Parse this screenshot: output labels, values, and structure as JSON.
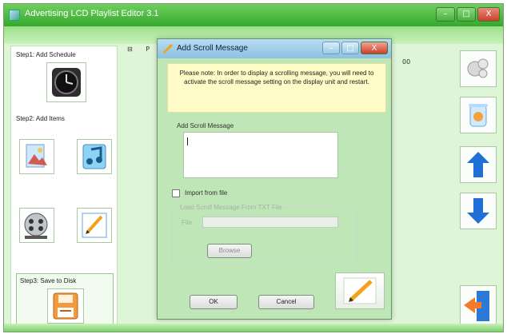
{
  "window": {
    "title": "Advertising LCD Playlist Editor 3.1",
    "controls": {
      "minimize": "–",
      "maximize": "□",
      "close": "X"
    }
  },
  "left_panel": {
    "step1_label": "Step1: Add Schedule",
    "step2_label": "Step2: Add Items",
    "step3_label": "Step3: Save to Disk"
  },
  "tree": {
    "root_glyph": "⊟",
    "root_text": "P",
    "time_text": "00"
  },
  "dialog": {
    "title": "Add Scroll Message",
    "note": "Please note: In order to display a scrolling message, you will need to activate the scroll message setting on the display unit and restart.",
    "group_label": "Add Scroll Message",
    "message_value": "",
    "import_label": "Import from file",
    "import_checked": false,
    "file_group_label": "Load Scroll Message From TXT File",
    "file_label": "File",
    "file_value": "",
    "browse_label": "Browse",
    "ok_label": "OK",
    "cancel_label": "Cancel"
  },
  "icons": {
    "clock": "clock-icon",
    "image": "image-icon",
    "music": "music-icon",
    "video": "film-reel-icon",
    "text": "pencil-note-icon",
    "save": "floppy-disk-icon",
    "settings": "gears-icon",
    "delete": "recycle-bin-icon",
    "up": "arrow-up-icon",
    "down": "arrow-down-icon",
    "exit": "exit-door-icon"
  },
  "colors": {
    "app_green": "#34a82c",
    "panel_tint": "#dff5d8",
    "note_bg": "#fffbc7",
    "arrow_blue": "#1f6fd6"
  }
}
